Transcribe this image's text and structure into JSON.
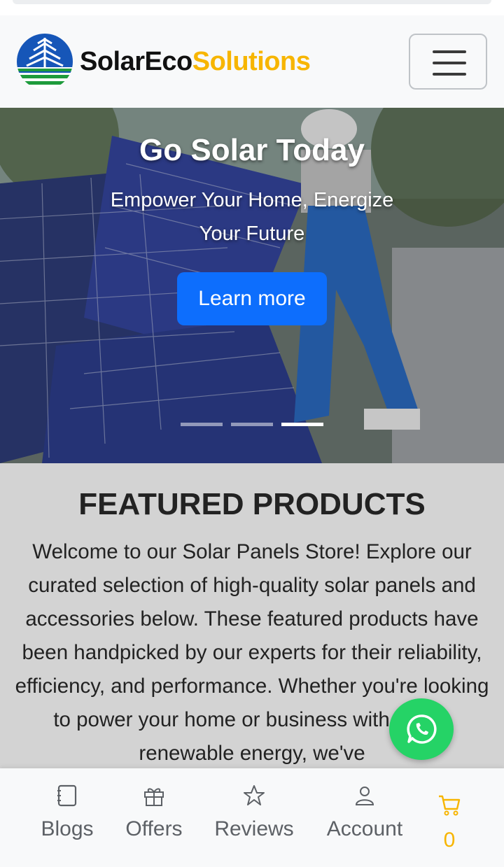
{
  "brand": {
    "name_part1": "SolarEco",
    "name_part2": "Solutions",
    "logo_icon": "solar-leaf-logo",
    "accent_color": "#f7b500"
  },
  "navbar": {
    "toggler_icon": "hamburger-menu-icon"
  },
  "hero": {
    "title": "Go Solar Today",
    "subtitle": "Empower Your Home, Energize Your Future",
    "cta_label": "Learn more",
    "cta_color": "#0d6efd",
    "slide_count": 3,
    "active_slide": 3
  },
  "featured": {
    "heading": "FEATURED PRODUCTS",
    "description": "Welcome to our Solar Panels Store! Explore our curated selection of high-quality solar panels and accessories below. These featured products have been handpicked by our experts for their reliability, efficiency, and performance. Whether you're looking to power your home or business with clean, renewable energy, we've"
  },
  "whatsapp": {
    "icon": "whatsapp-icon",
    "color": "#25d366"
  },
  "bottom_nav": {
    "items": [
      {
        "label": "Blogs",
        "icon": "notebook-icon"
      },
      {
        "label": "Offers",
        "icon": "gift-icon"
      },
      {
        "label": "Reviews",
        "icon": "star-icon"
      },
      {
        "label": "Account",
        "icon": "user-icon"
      }
    ],
    "cart": {
      "icon": "cart-icon",
      "count": "0"
    }
  }
}
